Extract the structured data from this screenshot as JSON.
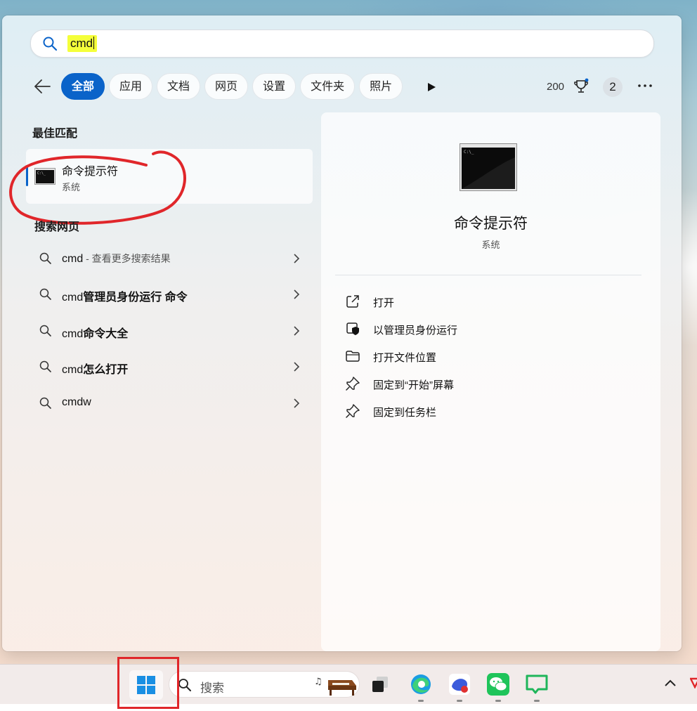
{
  "search": {
    "query": "cmd"
  },
  "filters": {
    "tabs": [
      "全部",
      "应用",
      "文档",
      "网页",
      "设置",
      "文件夹",
      "照片"
    ],
    "active_index": 0,
    "points": "200",
    "notification_count": "2"
  },
  "best_match": {
    "heading": "最佳匹配",
    "name": "命令提示符",
    "type": "系统"
  },
  "web_search": {
    "heading": "搜索网页",
    "items": [
      {
        "prefix": "cmd",
        "bold": "",
        "suffix": " - 查看更多搜索结果"
      },
      {
        "prefix": "cmd",
        "bold": "管理员身份运行 命令",
        "suffix": ""
      },
      {
        "prefix": "cmd",
        "bold": "命令大全",
        "suffix": ""
      },
      {
        "prefix": "cmd",
        "bold": "怎么打开",
        "suffix": ""
      },
      {
        "prefix": "cmdw",
        "bold": "",
        "suffix": ""
      }
    ]
  },
  "detail": {
    "title": "命令提示符",
    "subtitle": "系统",
    "actions": [
      {
        "label": "打开",
        "icon": "open-external-icon"
      },
      {
        "label": "以管理员身份运行",
        "icon": "admin-shield-icon"
      },
      {
        "label": "打开文件位置",
        "icon": "folder-icon"
      },
      {
        "label": "固定到“开始”屏幕",
        "icon": "pin-icon"
      },
      {
        "label": "固定到任务栏",
        "icon": "pin-icon"
      }
    ]
  },
  "taskbar": {
    "search_placeholder": "搜索",
    "apps": [
      "start-windows-icon",
      "task-view-icon",
      "edge-icon",
      "app-icon",
      "wechat-icon",
      "messages-icon"
    ]
  },
  "colors": {
    "accent": "#0a63c9",
    "annotation_red": "#e0262a",
    "highlight": "#f4ff3a"
  }
}
